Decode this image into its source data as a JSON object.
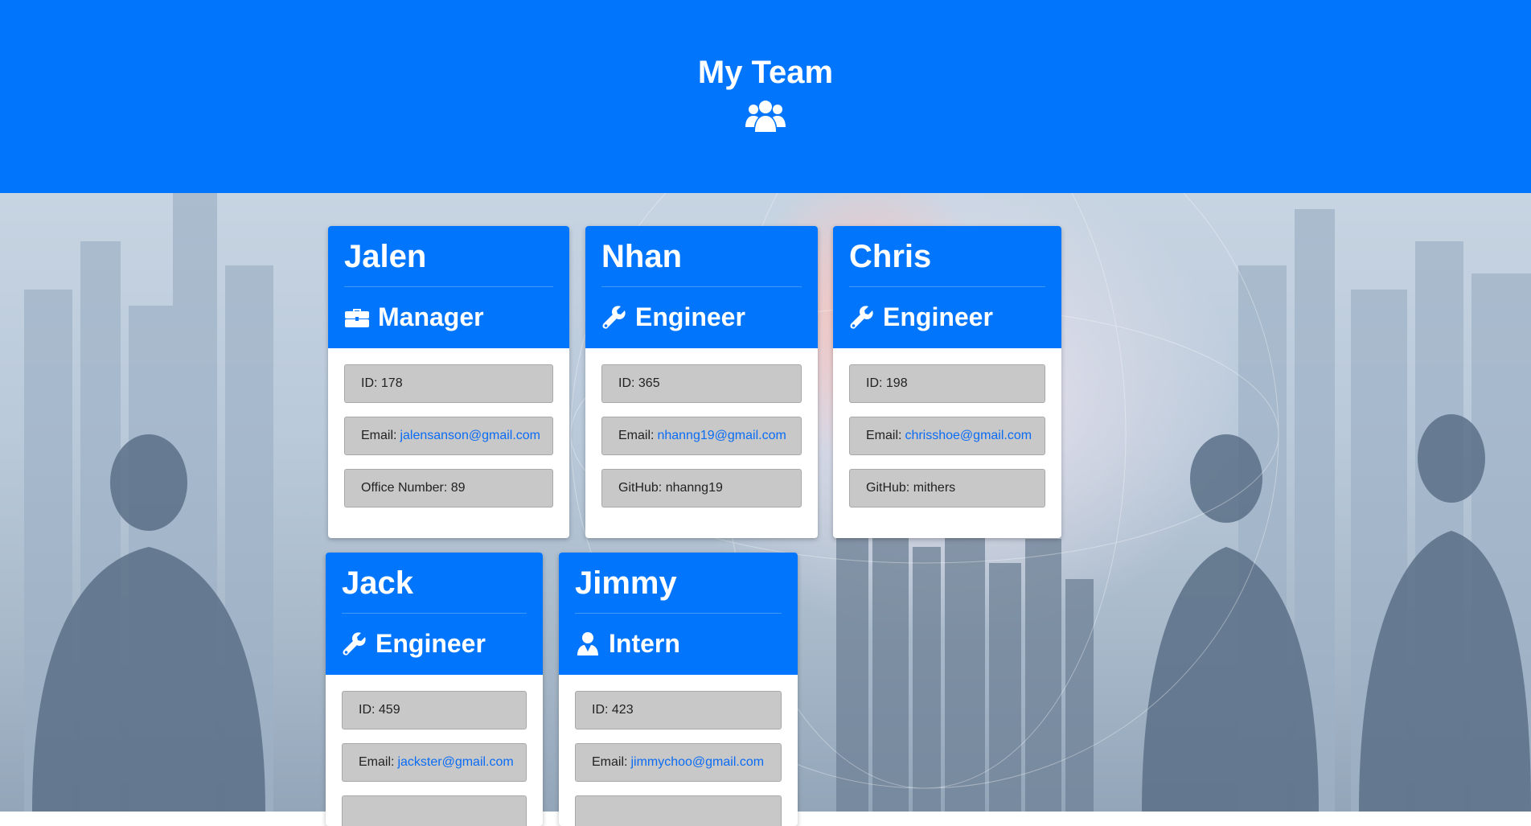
{
  "header": {
    "title": "My Team",
    "icon": "users-icon"
  },
  "colors": {
    "accent": "#0176fd",
    "field_bg": "#c8c8c8",
    "link": "#0a6cf5"
  },
  "employees": [
    {
      "name": "Jalen",
      "role": "Manager",
      "role_icon": "briefcase-icon",
      "id_text": "ID: 178",
      "email_label": "Email:",
      "email": "jalensanson@gmail.com",
      "extra_text": "Office Number: 89"
    },
    {
      "name": "Nhan",
      "role": "Engineer",
      "role_icon": "wrench-icon",
      "id_text": "ID: 365",
      "email_label": "Email:",
      "email": "nhanng19@gmail.com",
      "extra_text": "GitHub: nhanng19"
    },
    {
      "name": "Chris",
      "role": "Engineer",
      "role_icon": "wrench-icon",
      "id_text": "ID: 198",
      "email_label": "Email:",
      "email": "chrisshoe@gmail.com",
      "extra_text": "GitHub: mithers"
    },
    {
      "name": "Jack",
      "role": "Engineer",
      "role_icon": "wrench-icon",
      "id_text": "ID: 459",
      "email_label": "Email:",
      "email": "jackster@gmail.com"
    },
    {
      "name": "Jimmy",
      "role": "Intern",
      "role_icon": "user-icon",
      "id_text": "ID: 423",
      "email_label": "Email:",
      "email": "jimmychoo@gmail.com"
    }
  ]
}
